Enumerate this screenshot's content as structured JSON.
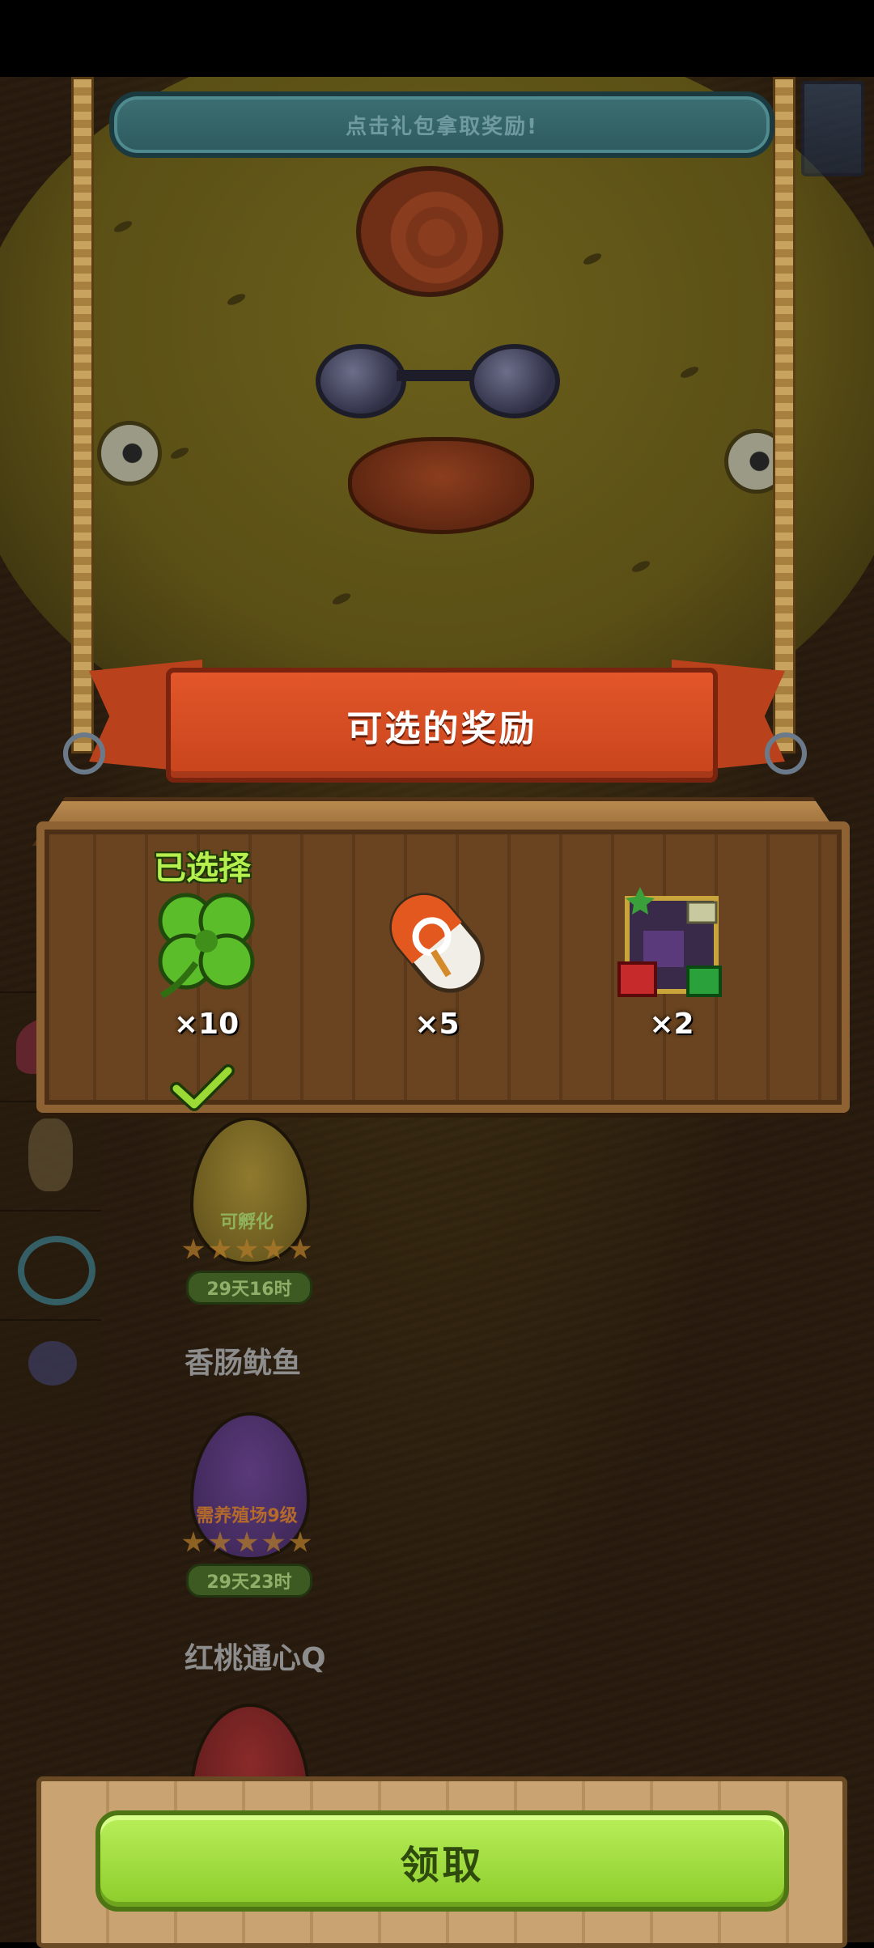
{
  "top_banner": {
    "text": "点击礼包拿取奖励!"
  },
  "reward_panel": {
    "title": "可选的奖励",
    "selected_label": "已选择",
    "items": [
      {
        "name": "four-leaf-clover",
        "quantity": "×10",
        "selected": true
      },
      {
        "name": "capsule-pill",
        "quantity": "×5",
        "selected": false
      },
      {
        "name": "gift-box-bundle",
        "quantity": "×2",
        "selected": false
      }
    ]
  },
  "pets": [
    {
      "egg_status": "可孵化",
      "stars": 5,
      "timer": "29天16时",
      "name": "香肠鱿鱼"
    },
    {
      "egg_status": "需养殖场9级",
      "stars": 5,
      "timer": "29天23时",
      "name": "红桃通心Q"
    }
  ],
  "actions": {
    "claim_label": "领取"
  },
  "colors": {
    "accent_green": "#9bd935",
    "ribbon_red": "#d84d22",
    "wood": "#8e6233"
  }
}
